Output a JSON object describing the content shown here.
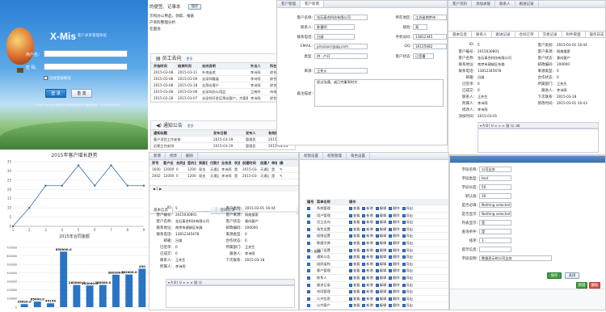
{
  "login": {
    "logo": "X-Mis",
    "tagline": "客户关系管理系统",
    "user_label": "用户名：",
    "pass_label": "密  码：",
    "remember": "记住登录账号",
    "login_btn": "登 录",
    "reset_btn": "重 置",
    "footer": "Power by 北京博客时代科技有限公司 客服热线：400-000-0000"
  },
  "desk": {
    "top_lines": [
      "的便签、记事本",
      "示和办公用品、领取、报备",
      "户资料整理分析",
      "在国会"
    ],
    "top_button": "保存",
    "staff_title": "员工去向",
    "staff_more": "更多",
    "staff_headers": [
      "开始时间",
      "结束时间",
      "去向说明",
      "外出人",
      "所在部门"
    ],
    "staff_rows": [
      [
        "2015-03-08",
        "2015-03-11",
        "外地出差",
        "李诗雨",
        "综合办公室"
      ],
      [
        "2015-03-08",
        "2015-03-09",
        "去深圳看展",
        "李诗雨",
        "综合办公室"
      ],
      [
        "2015-03-08",
        "2015-03-18",
        "去拜访客户",
        "李诗雨",
        "综合办公室"
      ],
      [
        "2015-03-08",
        "2015-03-09",
        "去深圳办公用品",
        "王晓玲",
        "市场部"
      ],
      [
        "2015-02-28",
        "2015-03-07",
        "去深圳开发区拜访客户，大客客需求确认与报价",
        "李诗雨",
        "综合办公室"
      ]
    ],
    "notice_title": "通知公告",
    "notice_more": "更多",
    "notice_headers": [
      "通知标题",
      "发布日期",
      "发布人",
      "有效期"
    ],
    "notice_rows": [
      [
        "客户项目工作安排",
        "2015-03-19",
        "管理员",
        "2015-03-16"
      ],
      [
        "近期工作安排",
        "2015-03-19",
        "管理员",
        "2015-03-23"
      ]
    ]
  },
  "charts": {
    "line_title": "2015年客户增长趋势",
    "bar_title": "2015年合同金额"
  },
  "chart_data": [
    {
      "type": "line",
      "title": "2015年客户增长趋势",
      "x": [
        1,
        2,
        3,
        4,
        5,
        6,
        7,
        8,
        9
      ],
      "y": [
        0,
        10,
        22,
        22,
        33,
        22,
        33,
        22,
        22
      ],
      "ylim": [
        0,
        35
      ],
      "yticks": [
        0,
        5,
        10,
        15,
        20,
        25,
        30,
        35
      ],
      "xlabel": "",
      "ylabel": ""
    },
    {
      "type": "bar",
      "title": "2015年合同金额",
      "categories": [
        "1",
        "2",
        "3",
        "4",
        "5",
        "6",
        "7",
        "8",
        "9",
        "10"
      ],
      "values": [
        35620.0,
        65000.0,
        45150.0,
        650000.0,
        260000.0,
        253000.0,
        260000.0,
        380200.0,
        382000.0,
        450000.0
      ],
      "data_labels": [
        "35620.0",
        "65000.0",
        "45150",
        "650000.0",
        "260000.0",
        "253000.0",
        "260000.0",
        "380200.0",
        "382000.0",
        "450"
      ],
      "ylim": [
        0,
        700000
      ],
      "yticks": [
        0,
        100000,
        200000,
        300000,
        400000,
        500000,
        600000,
        700000
      ]
    }
  ],
  "customer_form": {
    "tabs": [
      "客户管理",
      "客户新增"
    ],
    "fields": {
      "name_label": "客户名称:",
      "name_value": "金石泰合科技有限公司",
      "contact_label": "联系人:",
      "contact_value": "陈重明",
      "phone_label": "联系电话:",
      "phone_value": "吕维",
      "email_label": "EMAIL:",
      "email_value": "pinxiaocr@qq.com",
      "type_label": "类型:",
      "type_value": "供 · 户开",
      "src_label": "来源:",
      "src_value": "王失火",
      "remark_label": "备注描述:",
      "remark_value": "经过沟通，或已完事到时大",
      "region_label": "所在地区:",
      "region_value": "江苏省南京市",
      "level_label": "级别:",
      "level_value": "高",
      "mobile_label": "手机号码:",
      "mobile_value": "13812345",
      "qq_label": "QQ:",
      "qq_value": "16125682",
      "status_label": "客户状态:",
      "status_value": "已签署"
    }
  },
  "detail": {
    "tabs": [
      "客户资料",
      "添加关联",
      "联系人",
      "跟进记录"
    ],
    "subtabs": [
      "基本信息",
      "联系人",
      "跟进记录",
      "合同订单",
      "交易记录",
      "附件管理",
      "操作日志"
    ],
    "fields": [
      {
        "l": "ID:",
        "v": "5"
      },
      {
        "l": "客户编号:",
        "v": "2015030801"
      },
      {
        "l": "客户名称:",
        "v": "金石泰合科技有限公司"
      },
      {
        "l": "联系地址:",
        "v": "南京市建邺区东路"
      },
      {
        "l": "联系电话:",
        "v": "13812345678"
      },
      {
        "l": "邮箱:",
        "v": "吕维"
      },
      {
        "l": "已签单:",
        "v": "0"
      },
      {
        "l": "已成交:",
        "v": "0"
      },
      {
        "l": "联系人:",
        "v": "王先生"
      },
      {
        "l": "所属人:",
        "v": "李诗雨"
      },
      {
        "l": "修改人:",
        "v": "李诗雨"
      },
      {
        "l": "添加时间:",
        "v": "2015-03-01"
      }
    ],
    "right_fields": [
      {
        "l": "客户类别:",
        "v": "2015-03-01 16:44"
      },
      {
        "l": "客户来源:",
        "v": "网络搜索"
      },
      {
        "l": "客户状态:",
        "v": "意向客户"
      },
      {
        "l": "邮政编码:",
        "v": "200000"
      },
      {
        "l": "来源类型:",
        "v": "0"
      },
      {
        "l": "合作状态:",
        "v": "0"
      },
      {
        "l": "所属部门:",
        "v": "王先生"
      },
      {
        "l": "跟进人:",
        "v": "李诗雨"
      },
      {
        "l": "下次联系:",
        "v": "2015-03-18"
      },
      {
        "l": "修改时间:",
        "v": "2015-03-01 16:43"
      }
    ]
  },
  "list": {
    "toolbar": [
      "新增",
      "修改",
      "删除"
    ],
    "headers": [
      "序号",
      "客户名称",
      "合同金额",
      "签约日期",
      "到期日期",
      "付款方式",
      "业务员",
      "状态",
      "创建时间",
      "创建人",
      "审核",
      "操作"
    ],
    "rows": [
      [
        "16000",
        "12000",
        "0",
        "12000",
        "现金",
        "天通汇",
        "李诗雨",
        "是",
        "2015-03-16",
        "天通汇",
        "是",
        "✎"
      ],
      [
        "20026",
        "12000",
        "0",
        "12000",
        "现金",
        "天通汇",
        "李诗雨",
        "是",
        "2015-03-12",
        "天通汇",
        "是",
        "✎"
      ]
    ]
  },
  "perm": {
    "tabs": [
      "权限设置",
      "权限管理",
      "角色设置"
    ],
    "headers": [
      "编号",
      "菜单名称",
      "操作"
    ],
    "items": [
      "系统管理",
      "用户管理",
      "员工去向",
      "角色设置",
      "权限设置",
      "数据字典",
      "部门设置",
      "通知公告",
      "组织架构",
      "客户管理",
      "联系人",
      "跟进记录",
      "合同管理",
      "公共信息",
      "公共客户"
    ],
    "ops": [
      "查看",
      "新增",
      "编辑",
      "删除",
      "导出"
    ],
    "left_label": "(*) 系统"
  },
  "form2": {
    "fields": [
      {
        "l": "字段名称:",
        "v": "公司业务"
      },
      {
        "l": "字段类型:",
        "v": "text"
      },
      {
        "l": "字段长度:",
        "v": "50"
      },
      {
        "l": "默认值:",
        "v": "16"
      },
      {
        "l": "是否必填:",
        "v": "Nothing selected"
      },
      {
        "l": "是否显示:",
        "v": "Nothing selected"
      },
      {
        "l": "列表显示:",
        "v": "是"
      },
      {
        "l": "查询条件:",
        "v": "是"
      },
      {
        "l": "排序:",
        "v": "1"
      },
      {
        "l": "提示信息:",
        "v": ""
      },
      {
        "l": "字段说明:",
        "v": "数据显示的公司业务"
      }
    ],
    "save": "保存",
    "close": "关闭"
  }
}
